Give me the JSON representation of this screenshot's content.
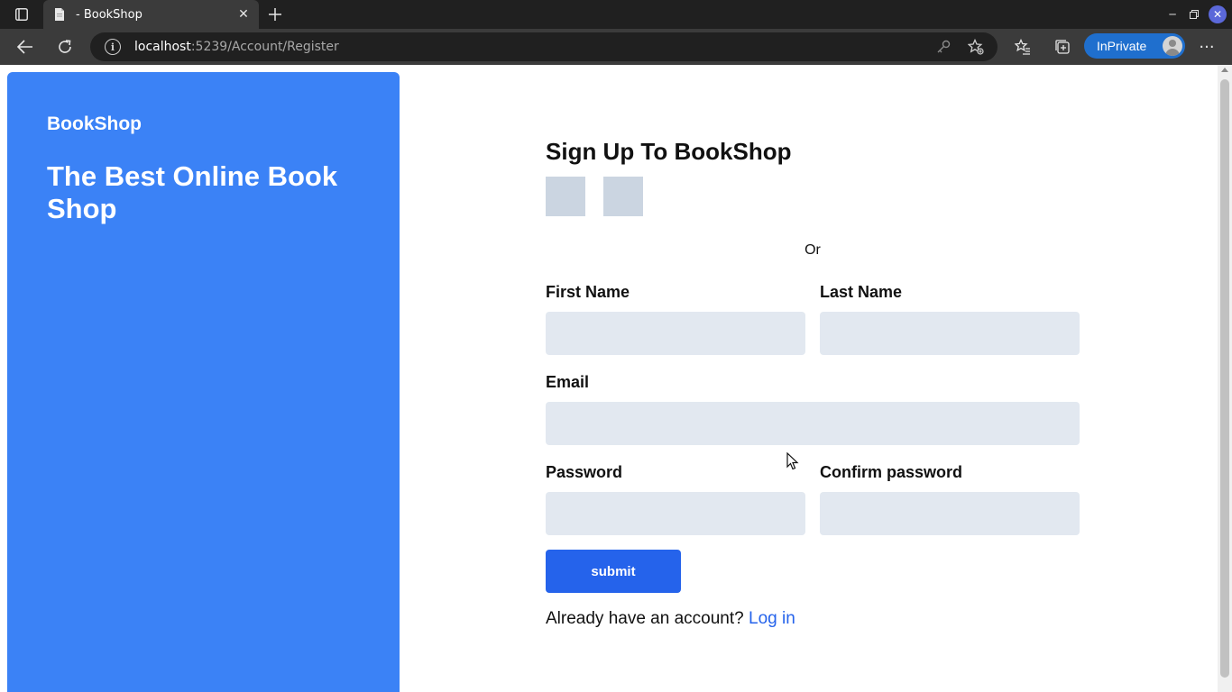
{
  "browser": {
    "tab_title": "- BookShop",
    "new_tab_icon": "plus-icon",
    "url_host": "localhost",
    "url_rest": ":5239/Account/Register",
    "inprivate_label": "InPrivate"
  },
  "hero": {
    "brand": "BookShop",
    "tagline": "The Best Online Book Shop",
    "background": "#3b82f6"
  },
  "form": {
    "title": "Sign Up To BookShop",
    "or_label": "Or",
    "first_name_label": "First Name",
    "first_name_value": "",
    "last_name_label": "Last Name",
    "last_name_value": "",
    "email_label": "Email",
    "email_value": "",
    "password_label": "Password",
    "password_value": "",
    "confirm_password_label": "Confirm password",
    "confirm_password_value": "",
    "submit_label": "submit",
    "already_text": "Already have an account? ",
    "login_link": "Log in",
    "accent": "#2563eb"
  }
}
